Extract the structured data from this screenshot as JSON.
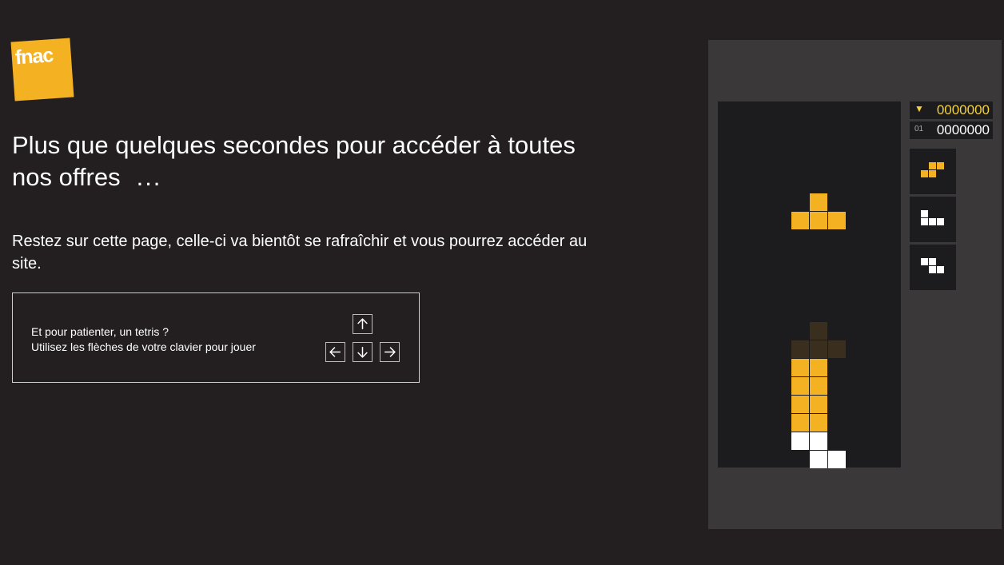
{
  "brand": {
    "logo_text": "fnac",
    "logo_color": "#f4b223"
  },
  "headline": "Plus que quelques secondes pour accéder à toutes nos offres",
  "headline_dots": "...",
  "subtext": "Restez sur cette page, celle-ci va bientôt se rafraîchir et vous pourrez accéder au site.",
  "game_box": {
    "line1": "Et pour patienter, un tetris ?",
    "line2": "Utilisez les flèches de votre clavier pour jouer",
    "keys": [
      "up-arrow",
      "left-arrow",
      "down-arrow",
      "right-arrow"
    ]
  },
  "tetris": {
    "high_score": "0000000",
    "score": "0000000",
    "level_label": "01",
    "trophy_icon": "trophy-icon",
    "colors": {
      "yellow": "#f4b223",
      "white": "#ffffff",
      "ghost": "#3a2f1e",
      "board": "#1c1b1d"
    }
  }
}
